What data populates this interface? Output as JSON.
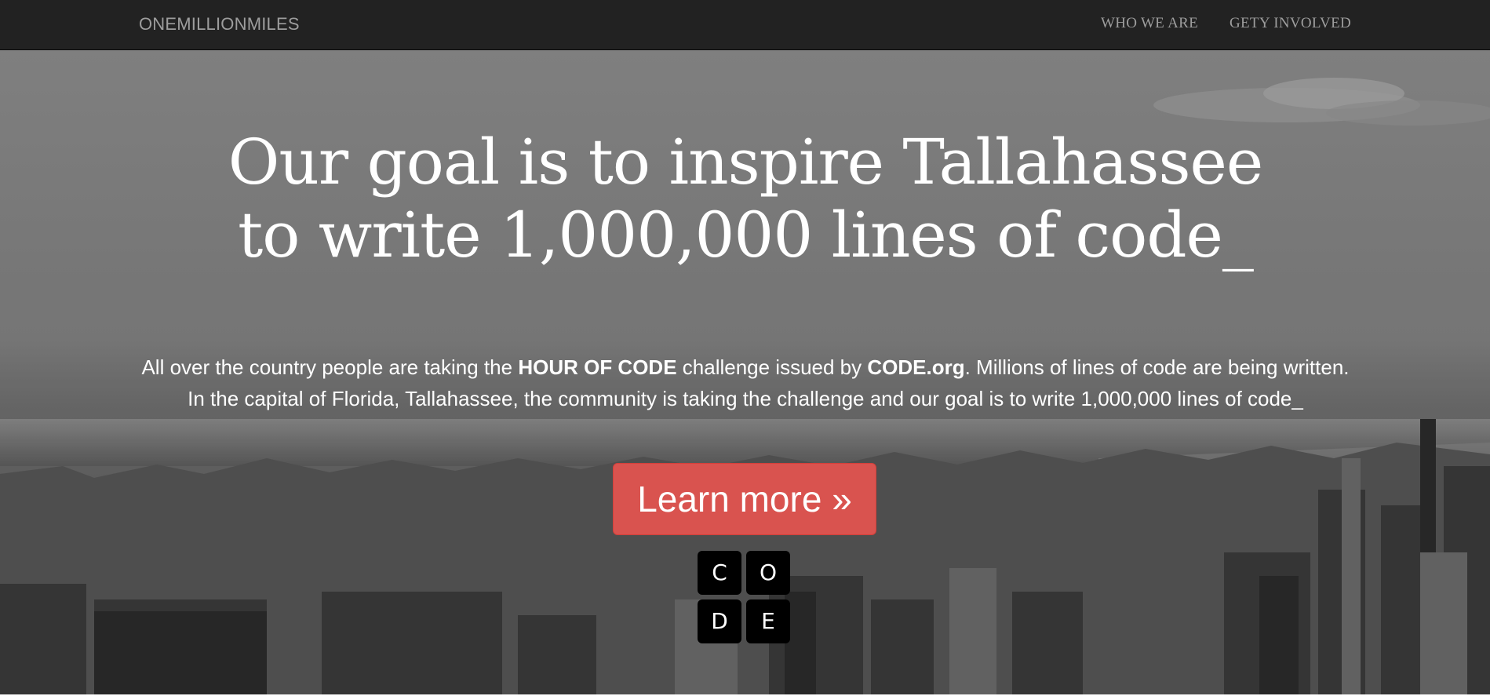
{
  "navbar": {
    "brand": "ONEMILLIONMILES",
    "links": [
      {
        "label": "WHO WE ARE"
      },
      {
        "label": "GETY INVOLVED"
      }
    ]
  },
  "hero": {
    "headline": "Our goal is to inspire Tallahassee to write 1,000,000 lines of code_",
    "lead": {
      "part1": "All over the country people are taking the ",
      "bold1": "HOUR OF CODE",
      "part2": " challenge issued by ",
      "bold2": "CODE.org",
      "part3": ". Millions of lines of code are being written. In the capital of Florida, Tallahassee, the community is taking the challenge and our goal is to write 1,000,000 lines of code_"
    },
    "cta_label": "Learn more »",
    "code_logo": [
      "C",
      "O",
      "D",
      "E"
    ]
  },
  "colors": {
    "navbar_bg": "#222222",
    "nav_text": "#9d9d9d",
    "cta_bg": "#d9534f",
    "logo_tile": "#000000"
  }
}
